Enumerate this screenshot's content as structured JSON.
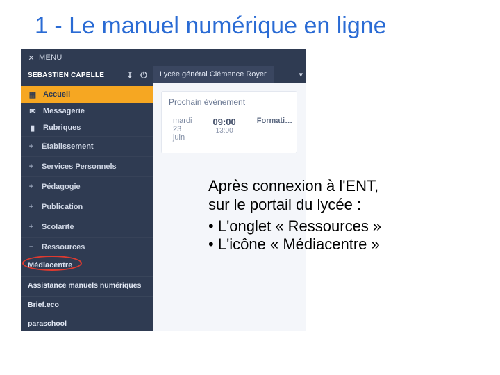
{
  "slide": {
    "title": "1 - Le manuel numérique en ligne"
  },
  "shot": {
    "menu_label": "MENU",
    "close_glyph": "✕",
    "user_name": "SEBASTIEN CAPELLE",
    "power_glyph": "⏻",
    "logout_glyph": "↧",
    "nav": {
      "accueil": "Accueil",
      "messagerie": "Messagerie",
      "rubriques": "Rubriques"
    },
    "sections": {
      "etablissement": "Établissement",
      "services": "Services Personnels",
      "pedagogie": "Pédagogie",
      "publication": "Publication",
      "scolarite": "Scolarité",
      "ressources": "Ressources"
    },
    "sub": {
      "mediacentre": "Médiacentre"
    },
    "bottom": {
      "assistance": "Assistance manuels numériques",
      "brief": "Brief.eco",
      "paraschool": "paraschool"
    },
    "tab": {
      "lycee": "Lycée général Clémence Royer",
      "caret": "▾"
    },
    "panel": {
      "title": "Prochain évènement",
      "date": "mardi 23 juin",
      "time_start": "09:00",
      "time_end": "13:00",
      "label": "Formati…"
    }
  },
  "instructions": {
    "line1": "Après connexion à l'ENT,",
    "line2": "sur le portail du lycée :",
    "bullet1": "L'onglet « Ressources »",
    "bullet2": "L'icône « Médiacentre »"
  }
}
